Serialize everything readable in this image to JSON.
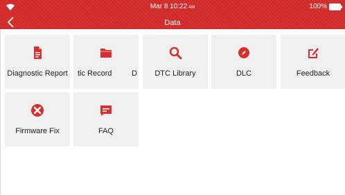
{
  "status_bar": {
    "time": "Mar 8 10:22",
    "ampm": "AM",
    "battery": "100%"
  },
  "header": {
    "title": "Data"
  },
  "tiles": [
    {
      "label": "Diagnostic Report",
      "icon": "report-document-icon"
    },
    {
      "label": "tic Record",
      "label_extra": "D",
      "icon": "folder-icon"
    },
    {
      "label": "DTC Library",
      "icon": "magnifier-icon"
    },
    {
      "label": "DLC",
      "icon": "compass-icon"
    },
    {
      "label": "Feedback",
      "icon": "edit-icon"
    },
    {
      "label": "Firmware Fix",
      "icon": "tools-icon"
    },
    {
      "label": "FAQ",
      "icon": "chat-icon"
    }
  ],
  "colors": {
    "brand_red": "#d42b2b",
    "tile_bg": "#f0f0f0",
    "icon_red": "#d92e2e"
  }
}
